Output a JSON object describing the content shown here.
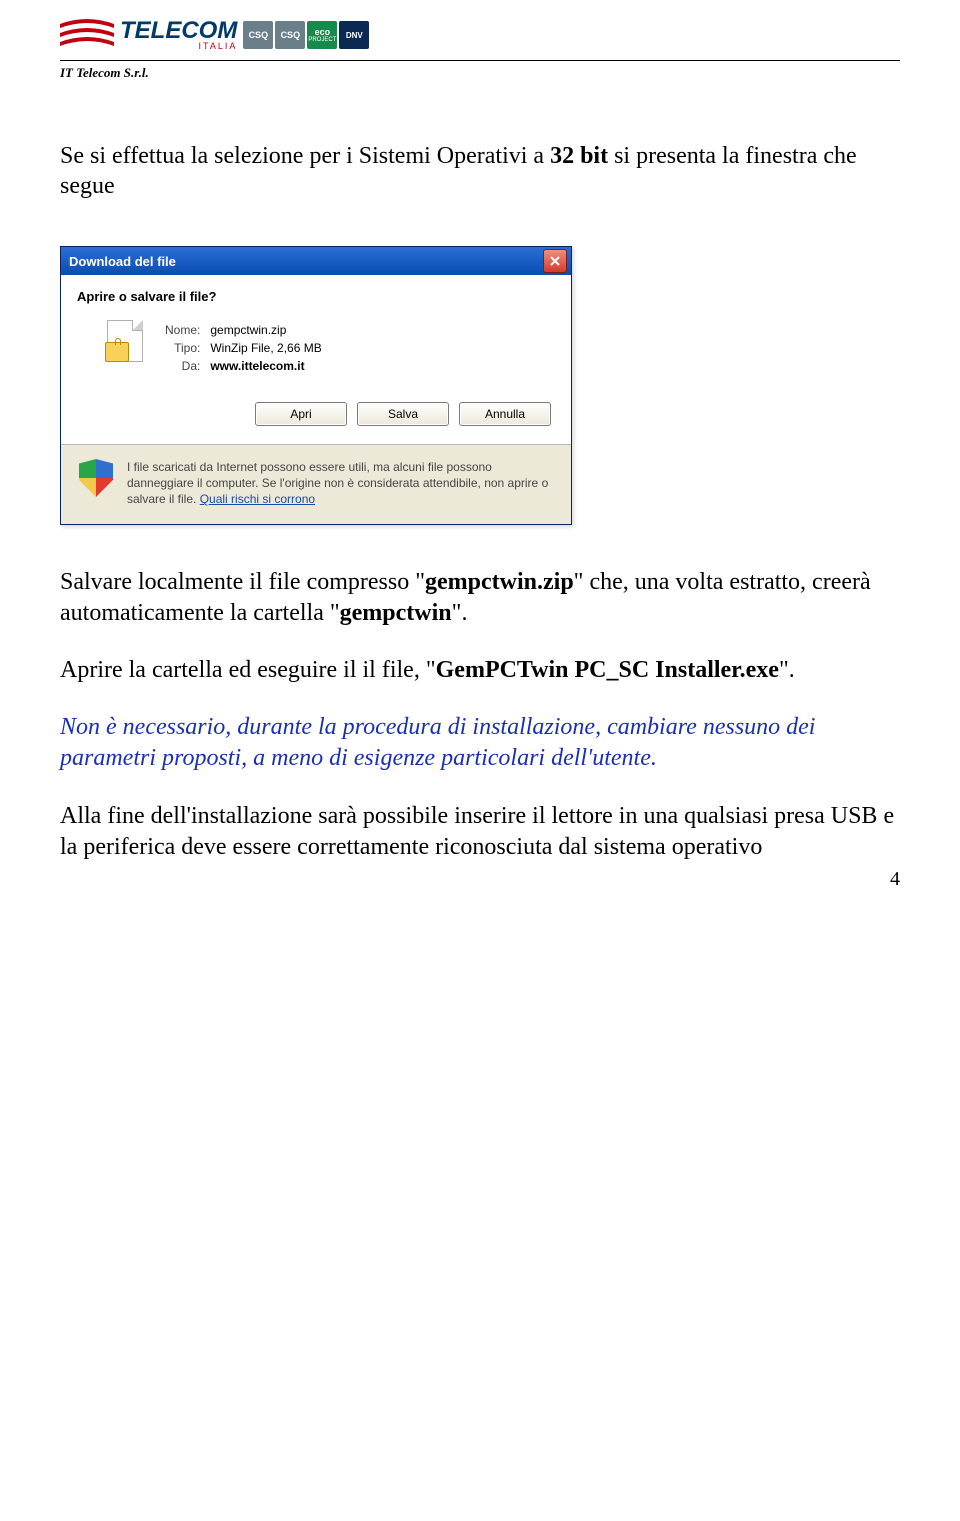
{
  "header": {
    "company_line": "IT Telecom S.r.l.",
    "logo_main": "TELECOM",
    "logo_sub": "ITALIA",
    "badges": {
      "csq": "CSQ",
      "eco": "eco",
      "eco_sub": "PROJECT",
      "dnv": "DNV"
    }
  },
  "intro": {
    "prefix": "Se si effettua la selezione per i Sistemi Operativi a ",
    "bits": "32 bit",
    "suffix": " si presenta la finestra che segue"
  },
  "dialog": {
    "title": "Download del file",
    "question": "Aprire o salvare il file?",
    "labels": {
      "name": "Nome:",
      "type": "Tipo:",
      "from": "Da:"
    },
    "file": {
      "name": "gempctwin.zip",
      "type": "WinZip File, 2,66 MB",
      "from": "www.ittelecom.it"
    },
    "buttons": {
      "open": "Apri",
      "save": "Salva",
      "cancel": "Annulla"
    },
    "warning": "I file scaricati da Internet possono essere utili, ma alcuni file possono danneggiare il computer. Se l'origine non è considerata attendibile, non aprire o salvare il file. ",
    "warning_link": "Quali rischi si corrono"
  },
  "body": {
    "p1_a": "Salvare localmente il file compresso \"",
    "p1_b": "gempctwin.zip",
    "p1_c": "\" che, una volta estratto, creerà automaticamente la cartella \"",
    "p1_d": "gempctwin",
    "p1_e": "\".",
    "p2_a": "Aprire la cartella ed eseguire il il file, \"",
    "p2_b": "GemPCTwin PC_SC Installer.exe",
    "p2_c": "\".",
    "note": "Non è necessario, durante la procedura di installazione, cambiare nessuno dei parametri proposti, a meno di esigenze particolari dell'utente.",
    "p3": "Alla fine dell'installazione sarà possibile inserire il lettore in una qualsiasi presa USB e la periferica deve essere correttamente riconosciuta  dal sistema operativo"
  },
  "page_number": "4"
}
